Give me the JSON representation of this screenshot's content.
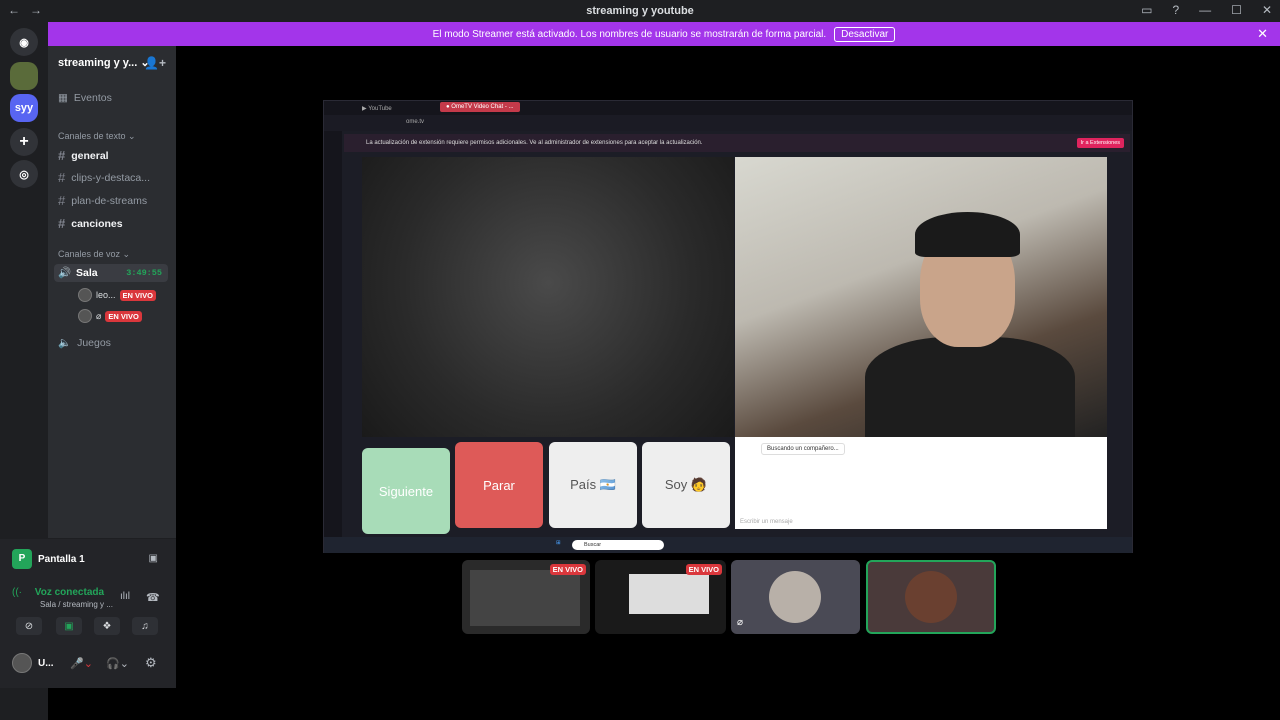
{
  "window": {
    "title": "streaming y youtube",
    "nav_back": "←",
    "nav_fwd": "→"
  },
  "banner": {
    "text": "El modo Streamer está activado. Los nombres de usuario se mostrarán de forma parcial.",
    "button": "Desactivar"
  },
  "server": {
    "name": "streaming y y...",
    "syy_label": "syy"
  },
  "sidebar": {
    "events": "Eventos",
    "text_category": "Canales de texto",
    "text_channels": [
      "general",
      "clips-y-destaca...",
      "plan-de-streams",
      "canciones"
    ],
    "voice_category": "Canales de voz",
    "voice_channel": "Sala",
    "voice_time": "3:49:55",
    "voice_users": [
      {
        "name": "leo...",
        "badge": "EN VIVO"
      },
      {
        "name": "",
        "badge": "EN VIVO"
      }
    ],
    "voice_channel_2": "Juegos"
  },
  "user_panel": {
    "screen_share": "Pantalla 1",
    "voice_status": "Voz conectada",
    "voice_location": "Sala / streaming y ...",
    "user_short": "U..."
  },
  "shared_screen": {
    "tab1": "YouTube",
    "tab2": "OmeTV Video Chat - ...",
    "url": "ome.tv",
    "notice": "La actualización de extensión requiere permisos adicionales. Ve al administrador de extensiones para aceptar la actualización.",
    "notice_button": "Ir a Extensiones",
    "buttons": {
      "next": "Siguiente",
      "stop": "Parar",
      "country": "País 🇦🇷",
      "me": "Soy 🧑"
    },
    "chat_msg": "Buscando un compañero...",
    "chat_placeholder": "Escribir un mensaje",
    "taskbar_search": "Buscar"
  },
  "tiles": [
    {
      "badge": "EN VIVO"
    },
    {
      "badge": "EN VIVO"
    }
  ],
  "colors": {
    "banner": "#a335ea",
    "live": "#da373c",
    "connected": "#23a55a",
    "next_btn": "#a8dcb8",
    "stop_btn": "#de5a58"
  }
}
